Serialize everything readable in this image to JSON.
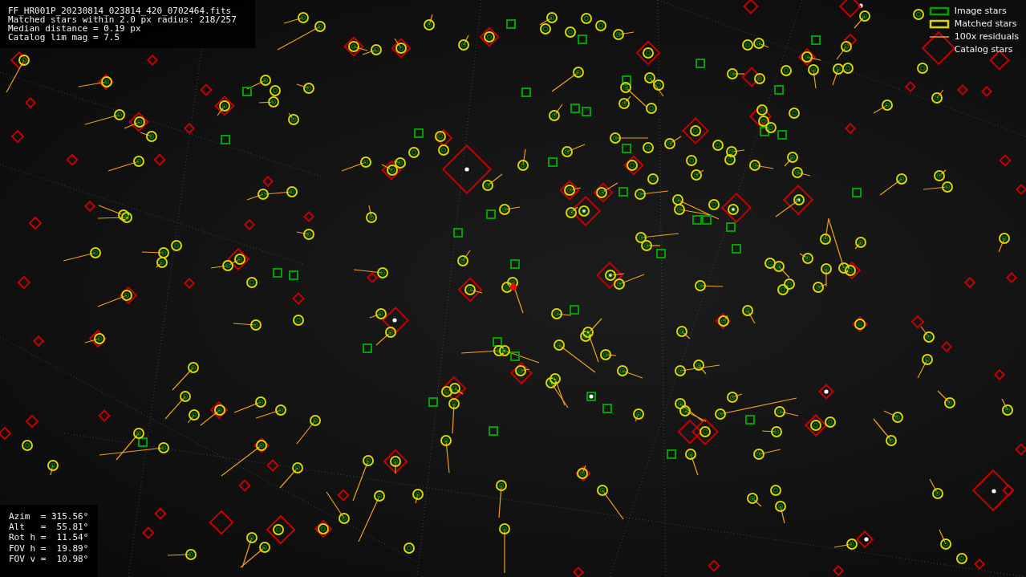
{
  "header": {
    "lines": [
      "FF_HR001P_20230814_023814_420_0702464.fits",
      "Matched stars within 2.0 px radius: 218/257",
      "Median distance = 0.19 px",
      "Catalog lim mag = 7.5"
    ]
  },
  "legend": [
    {
      "label": "Image stars",
      "kind": "image"
    },
    {
      "label": "Matched stars",
      "kind": "matched"
    },
    {
      "label": "100x residuals",
      "kind": "residual"
    },
    {
      "label": "Catalog stars",
      "kind": "catalog"
    }
  ],
  "pointing": [
    "Azim  = 315.56°",
    "Alt   =  55.81°",
    "Rot h =  11.54°",
    "FOV h =  19.89°",
    "FOV v =  10.98°"
  ]
}
